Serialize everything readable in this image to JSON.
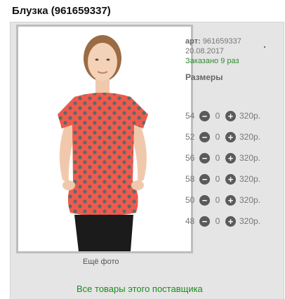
{
  "product": {
    "title": "Блузка (961659337)",
    "art_label": "арт:",
    "art_value": "961659337",
    "date": "20.08.2017",
    "ordered": "Заказано 9 раз",
    "more_photo": "Ещё фото",
    "sizes_title": "Размеры",
    "supplier_link": "Все товары этого поставщика"
  },
  "sizes": [
    {
      "size": "54",
      "qty": "0",
      "price": "320р."
    },
    {
      "size": "52",
      "qty": "0",
      "price": "320р."
    },
    {
      "size": "56",
      "qty": "0",
      "price": "320р."
    },
    {
      "size": "58",
      "qty": "0",
      "price": "320р."
    },
    {
      "size": "50",
      "qty": "0",
      "price": "320р."
    },
    {
      "size": "48",
      "qty": "0",
      "price": "320р."
    }
  ],
  "icons": {
    "minus": "minus-circle-icon",
    "plus": "plus-circle-icon"
  },
  "colors": {
    "link_green": "#1f8a1f",
    "blouse_coral": "#ef5a4e",
    "dots_teal": "#3d6f6c"
  }
}
